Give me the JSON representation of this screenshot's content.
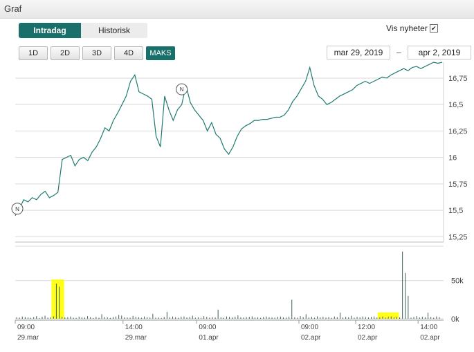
{
  "panel": {
    "title": "Graf"
  },
  "view_tabs": [
    {
      "label": "Intradag",
      "active": true
    },
    {
      "label": "Historisk",
      "active": false
    }
  ],
  "news_toggle": {
    "label": "Vis nyheter",
    "checked": true,
    "mark": "✔"
  },
  "periods": [
    {
      "label": "1D",
      "active": false
    },
    {
      "label": "2D",
      "active": false
    },
    {
      "label": "3D",
      "active": false
    },
    {
      "label": "4D",
      "active": false
    },
    {
      "label": "MAKS",
      "active": true
    }
  ],
  "date_range": {
    "from": "mar 29, 2019",
    "separator": "–",
    "to": "apr 2, 2019"
  },
  "colors": {
    "accent": "#19706a",
    "line": "#1e7a70",
    "volume": "#3b5f58",
    "highlight": "#ffff00"
  },
  "chart_data": [
    {
      "type": "line",
      "y_ticks": [
        "16,75",
        "16,5",
        "16,25",
        "16",
        "15,75",
        "15,5",
        "15,25"
      ],
      "y_tick_values": [
        16.75,
        16.5,
        16.25,
        16.0,
        15.75,
        15.5,
        15.25
      ],
      "ylim": [
        15.2,
        16.9
      ],
      "grid": true,
      "x": [
        0,
        2,
        4,
        6,
        8,
        10,
        12,
        14,
        16,
        18,
        20,
        22,
        24,
        26,
        28,
        30,
        32,
        34,
        36,
        38,
        40,
        42,
        44,
        46,
        48,
        50,
        52,
        54,
        56,
        58,
        60,
        62,
        64,
        66,
        68,
        70,
        72,
        74,
        76,
        78,
        80,
        82,
        84,
        86,
        88,
        90,
        92,
        94,
        96,
        98,
        100,
        102,
        104,
        106,
        108,
        110,
        112,
        114,
        116,
        118,
        120,
        122,
        124,
        126,
        128,
        130,
        132,
        134,
        136,
        138,
        140,
        142,
        144,
        146,
        148,
        150,
        152,
        154,
        156,
        158,
        160,
        162,
        164,
        166,
        168,
        170,
        172,
        174,
        176,
        178,
        180,
        182,
        184,
        186,
        188,
        190,
        192,
        194,
        196,
        198,
        200
      ],
      "values": [
        15.45,
        15.52,
        15.6,
        15.58,
        15.62,
        15.6,
        15.65,
        15.68,
        15.62,
        15.64,
        15.67,
        15.98,
        16.0,
        16.02,
        15.92,
        15.98,
        16.0,
        15.97,
        16.05,
        16.1,
        16.18,
        16.28,
        16.25,
        16.35,
        16.42,
        16.5,
        16.58,
        16.72,
        16.78,
        16.62,
        16.6,
        16.58,
        16.55,
        16.2,
        16.1,
        16.58,
        16.45,
        16.35,
        16.45,
        16.5,
        16.68,
        16.52,
        16.45,
        16.4,
        16.35,
        16.25,
        16.33,
        16.22,
        16.18,
        16.08,
        16.03,
        16.1,
        16.2,
        16.27,
        16.3,
        16.32,
        16.35,
        16.35,
        16.36,
        16.36,
        16.37,
        16.38,
        16.38,
        16.4,
        16.45,
        16.53,
        16.58,
        16.65,
        16.72,
        16.85,
        16.68,
        16.58,
        16.55,
        16.5,
        16.52,
        16.55,
        16.58,
        16.6,
        16.62,
        16.64,
        16.68,
        16.7,
        16.72,
        16.7,
        16.72,
        16.74,
        16.76,
        16.75,
        16.78,
        16.8,
        16.82,
        16.84,
        16.82,
        16.85,
        16.86,
        16.84,
        16.86,
        16.88,
        16.9,
        16.89,
        16.9
      ],
      "news_markers": [
        {
          "x": 0,
          "label": "N"
        },
        {
          "x": 78,
          "label": "N"
        }
      ]
    },
    {
      "type": "bar",
      "y_ticks": [
        "50k",
        "0k"
      ],
      "y_tick_values": [
        50000,
        0
      ],
      "ylim": [
        0,
        95000
      ],
      "x_ticks": [
        {
          "time": "09:00",
          "date": "29.mar"
        },
        {
          "time": "14:00",
          "date": "29.mar"
        },
        {
          "time": "09:00",
          "date": "01.apr"
        },
        {
          "time": "09:00",
          "date": "02.apr"
        },
        {
          "time": "12:00",
          "date": "02.apr"
        },
        {
          "time": "14:00",
          "date": "02.apr"
        }
      ],
      "x_tick_positions": [
        0,
        38,
        64,
        100,
        120,
        142
      ],
      "xlim": [
        0,
        150
      ],
      "values": [
        2000,
        1500,
        3000,
        2500,
        1800,
        1200,
        2200,
        3500,
        1000,
        2800,
        4000,
        1500,
        2000,
        3200,
        46000,
        42000,
        2500,
        1800,
        2200,
        3000,
        1500,
        1200,
        2800,
        2000,
        1600,
        3500,
        2200,
        1000,
        2700,
        1500,
        6000,
        2300,
        1800,
        1200,
        2500,
        3000,
        5000,
        4200,
        2000,
        1800,
        1500,
        3800,
        2600,
        2200,
        1200,
        3000,
        2000,
        1700,
        6500,
        1500,
        1800,
        1100,
        2500,
        9000,
        2000,
        3000,
        2200,
        1400,
        2800,
        3000,
        1800,
        2500,
        4000,
        1500,
        2000,
        1200,
        3500,
        2500,
        1600,
        2200,
        1800,
        12000,
        2100,
        1500,
        3000,
        2500,
        1800,
        2800,
        4500,
        2000,
        1700,
        2300,
        2600,
        3200,
        1800,
        2000,
        1400,
        2500,
        3000,
        2200,
        1800,
        1500,
        2700,
        3000,
        2000,
        1600,
        2800,
        25000,
        2000,
        1500,
        3500,
        2200,
        6000,
        1800,
        2500,
        1500,
        3200,
        2000,
        2800,
        1700,
        2400,
        1300,
        3000,
        2200,
        8000,
        1800,
        2500,
        2000,
        4000,
        1500,
        2600,
        1900,
        3000,
        2200,
        1800,
        2500,
        3100,
        1700,
        2000,
        2800,
        1500,
        2300,
        3000,
        2100,
        2600,
        1800,
        88000,
        60000,
        30000,
        1500,
        2400,
        3500,
        1800,
        2600,
        2000,
        8000,
        2500,
        1500,
        3000,
        2200
      ],
      "highlights": [
        {
          "from": 13,
          "to": 16
        },
        {
          "from": 128,
          "to": 134
        }
      ]
    }
  ]
}
